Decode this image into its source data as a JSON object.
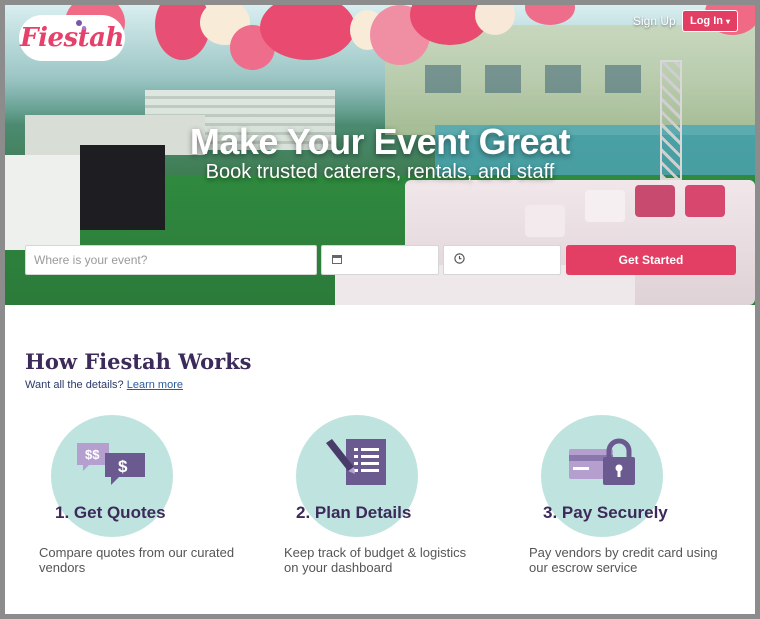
{
  "brand": {
    "logo_text": "Fiestah"
  },
  "nav": {
    "signup_label": "Sign Up",
    "login_label": "Log In"
  },
  "hero": {
    "title": "Make Your Event Great",
    "subtitle": "Book trusted caterers, rentals, and staff"
  },
  "search": {
    "location_placeholder": "Where is your event?",
    "date_value": "",
    "time_value": "",
    "cta_label": "Get Started"
  },
  "how": {
    "title": "How Fiestah Works",
    "subtitle_text": "Want all the details?",
    "learn_more": "Learn more",
    "steps": [
      {
        "title": "1. Get Quotes",
        "desc": "Compare quotes from our curated vendors",
        "icon": "quotes-chat-icon"
      },
      {
        "title": "2. Plan Details",
        "desc": "Keep track of budget & logistics on your dashboard",
        "icon": "pen-document-icon"
      },
      {
        "title": "3. Pay Securely",
        "desc": "Pay vendors by credit card using our escrow service",
        "icon": "credit-card-lock-icon"
      }
    ]
  },
  "colors": {
    "brand_pink": "#e33e63",
    "heading_purple": "#3c2a5a",
    "icon_circle": "#bfe4df",
    "icon_purple": "#7a6a9c"
  }
}
